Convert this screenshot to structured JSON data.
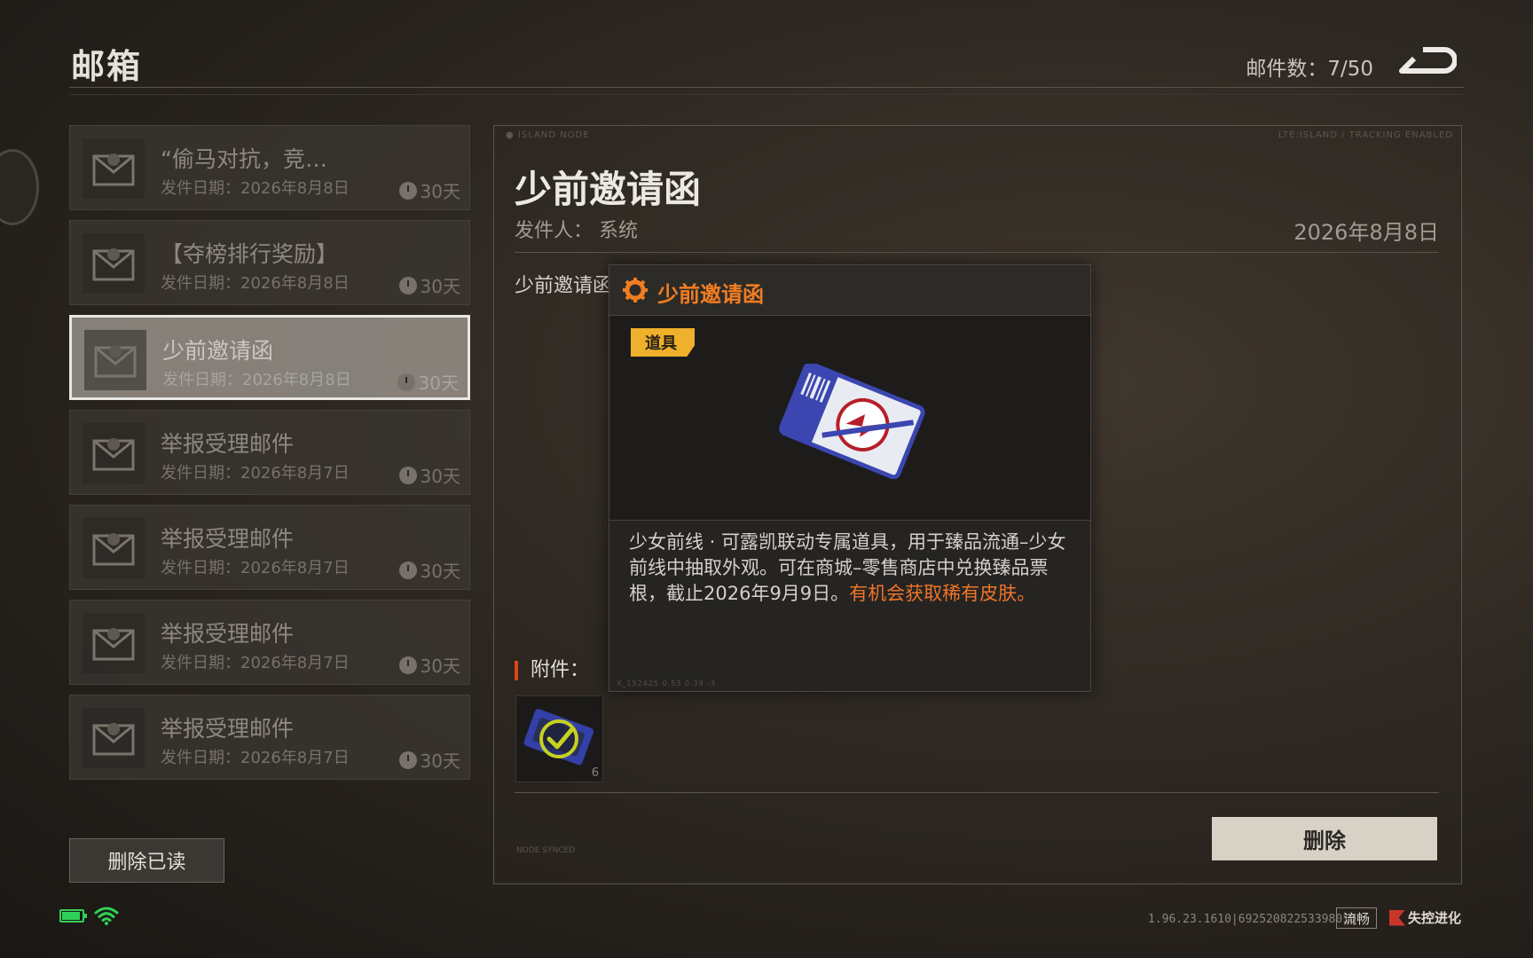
{
  "header": {
    "title": "邮箱",
    "mail_count": "邮件数：7/50",
    "back_icon": "back-arrow-icon"
  },
  "mail_list": [
    {
      "title": "“偷马对抗，竞…",
      "date": "发件日期：2026年8月8日",
      "expire": "30天",
      "selected": false
    },
    {
      "title": "【夺榜排行奖励】",
      "date": "发件日期：2026年8月8日",
      "expire": "30天",
      "selected": false
    },
    {
      "title": "少前邀请函",
      "date": "发件日期：2026年8月8日",
      "expire": "30天",
      "selected": true
    },
    {
      "title": "举报受理邮件",
      "date": "发件日期：2026年8月7日",
      "expire": "30天",
      "selected": false
    },
    {
      "title": "举报受理邮件",
      "date": "发件日期：2026年8月7日",
      "expire": "30天",
      "selected": false
    },
    {
      "title": "举报受理邮件",
      "date": "发件日期：2026年8月7日",
      "expire": "30天",
      "selected": false
    },
    {
      "title": "举报受理邮件",
      "date": "发件日期：2026年8月7日",
      "expire": "30天",
      "selected": false
    }
  ],
  "delete_read_label": "删除已读",
  "detail": {
    "tag_left": "● ISLAND NODE",
    "tag_right": "LTE:ISLAND / TRACKING ENABLED",
    "title": "少前邀请函",
    "sender": "发件人：  系统",
    "date": "2026年8月8日",
    "body": "少前邀请函",
    "attach_label": "附件：",
    "attach_count": "6",
    "delete_label": "删除",
    "tag_bottom": "NODE SYNCED"
  },
  "popup": {
    "title": "少前邀请函",
    "type_badge": "道具",
    "desc_main": "少女前线 · 可露凯联动专属道具，用于臻品流通–少女前线中抽取外观。可在商城–零售商店中兑换臻品票根，截止2026年9月9日。",
    "desc_highlight": "有机会获取稀有皮肤。",
    "footer": "X_152425  0.53  0.39  -3"
  },
  "status": {
    "version": "1.96.23.1610|69252082253398018",
    "fluency": "流畅",
    "brand": "失控进化"
  },
  "colors": {
    "accent_orange": "#f07d22",
    "badge_yellow": "#efb02c",
    "battery_green": "#30d158"
  }
}
